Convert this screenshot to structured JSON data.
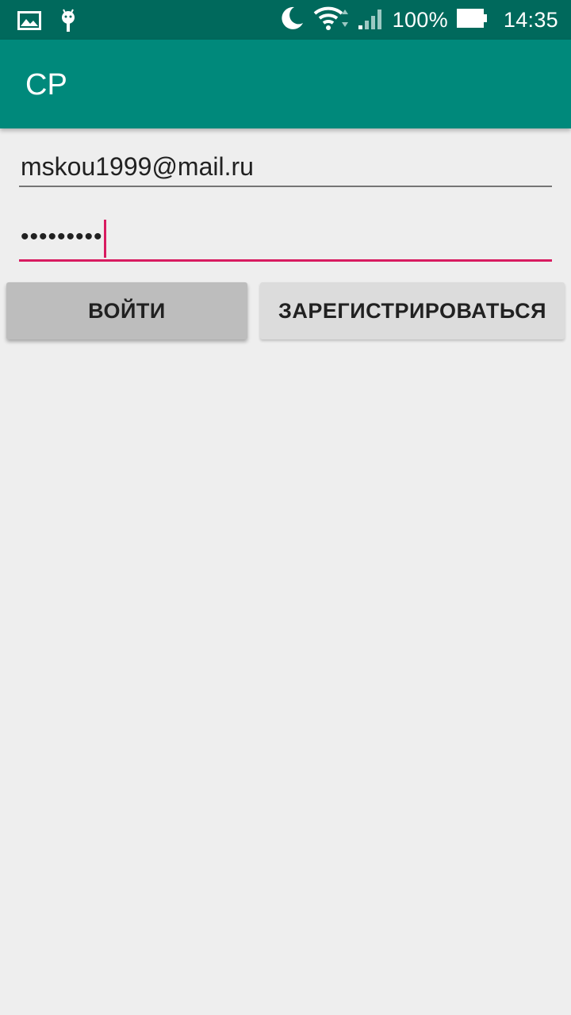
{
  "status_bar": {
    "icons_left": [
      "image-notification-icon",
      "android-notification-icon"
    ],
    "icons_right": [
      "moon-icon",
      "wifi-icon",
      "signal-icon",
      "battery-icon"
    ],
    "battery": "100%",
    "time": "14:35"
  },
  "app_bar": {
    "title": "CP",
    "color": "#00897b"
  },
  "form": {
    "email_value": "mskou1999@mail.ru",
    "password_value": "•••••••••",
    "login_label": "ВОЙТИ",
    "register_label": "ЗАРЕГИСТРИРОВАТЬСЯ",
    "accent_color": "#d81b60"
  }
}
